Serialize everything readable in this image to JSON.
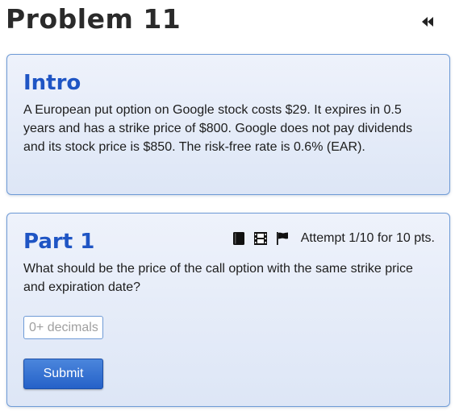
{
  "problem": {
    "title": "Problem 11"
  },
  "intro": {
    "heading": "Intro",
    "text": "A European put option on Google stock costs $29. It expires in 0.5 years and has a strike price of $800. Google does not pay dividends and its stock price is $850. The risk-free rate is 0.6% (EAR)."
  },
  "part1": {
    "heading": "Part 1",
    "attempt": "Attempt 1/10 for 10 pts.",
    "question": "What should be the price of the call option with the same strike price and expiration date?",
    "input_placeholder": "0+ decimals",
    "input_value": "",
    "submit_label": "Submit",
    "icons": [
      "book-icon",
      "film-icon",
      "flag-icon"
    ]
  },
  "colors": {
    "accent": "#1f55c4",
    "card_border": "#6f9bd6",
    "card_bg": "#e6ecf8",
    "button": "#2f6ccf"
  }
}
